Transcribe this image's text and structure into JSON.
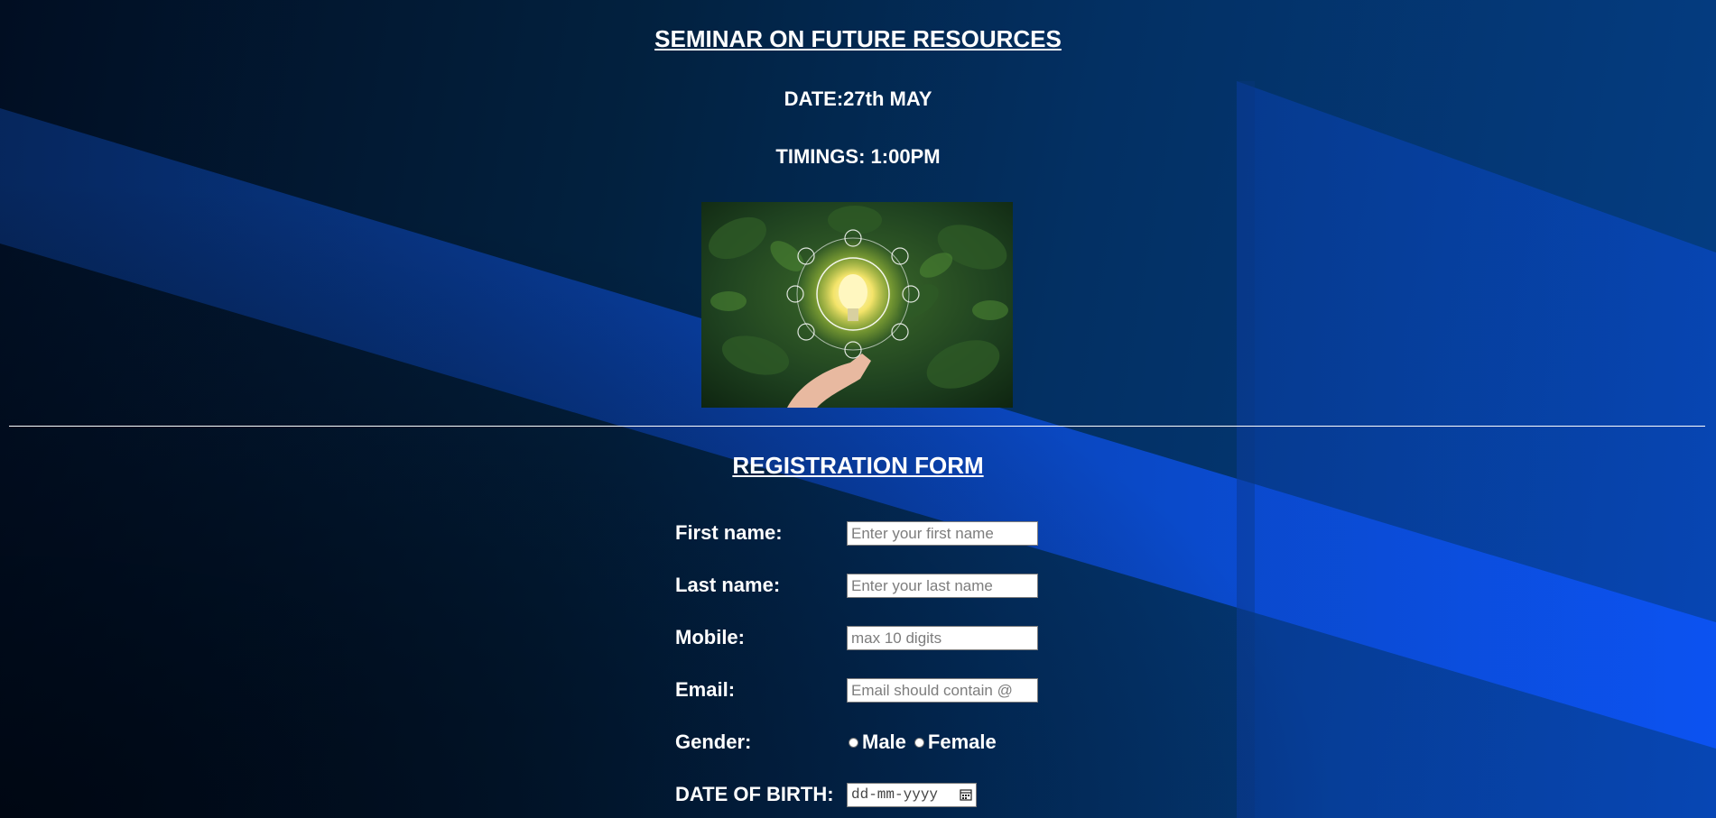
{
  "header": {
    "title": "SEMINAR ON FUTURE RESOURCES",
    "date": "DATE:27th MAY",
    "timings": "TIMINGS: 1:00PM"
  },
  "hero_image": {
    "alt": "seminar image"
  },
  "form": {
    "title": "REGISTRATION FORM",
    "first_name": {
      "label": "First name:",
      "placeholder": "Enter your first name",
      "value": ""
    },
    "last_name": {
      "label": "Last name:",
      "placeholder": "Enter your last name",
      "value": ""
    },
    "mobile": {
      "label": "Mobile:",
      "placeholder": "max 10 digits",
      "value": ""
    },
    "email": {
      "label": "Email:",
      "placeholder": "Email should contain @",
      "value": ""
    },
    "gender": {
      "label": "Gender:",
      "options": [
        "Male",
        "Female"
      ]
    },
    "dob": {
      "label": "DATE OF BIRTH:",
      "placeholder": "dd-mm-yyyy"
    }
  },
  "icons": {
    "calendar": "calendar-icon"
  },
  "colors": {
    "text": "#ffffff",
    "background_dark": "#021a3a",
    "background_light": "#0a4bd6",
    "divider": "#ffffff"
  }
}
